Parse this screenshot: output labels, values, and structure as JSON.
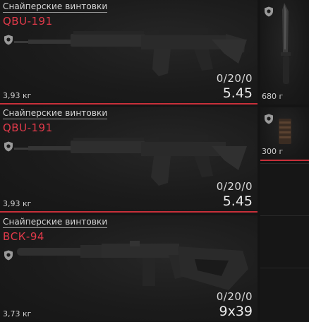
{
  "weapons": [
    {
      "category": "Снайперские винтовки",
      "name": "QBU-191",
      "weight": "3,93 кг",
      "ammo": "0/20/0",
      "caliber": "5.45"
    },
    {
      "category": "Снайперские винтовки",
      "name": "QBU-191",
      "weight": "3,93 кг",
      "ammo": "0/20/0",
      "caliber": "5.45"
    },
    {
      "category": "Снайперские винтовки",
      "name": "ВСК-94",
      "weight": "3,73 кг",
      "ammo": "0/20/0",
      "caliber": "9x39"
    }
  ],
  "side_items": [
    {
      "weight": "680 г",
      "icon": "knife-icon"
    },
    {
      "weight": "300 г",
      "icon": "magazine-icon"
    }
  ],
  "colors": {
    "accent": "#e23a4a",
    "divider": "#c8303a"
  }
}
